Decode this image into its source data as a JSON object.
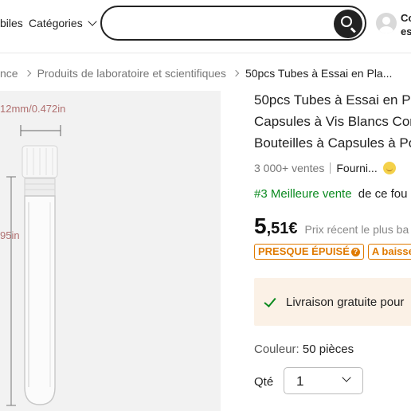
{
  "header": {
    "nav_mobiles": "biles",
    "nav_categories": "Catégories",
    "search": {
      "value": "",
      "placeholder": ""
    },
    "account_line1": "Co",
    "account_line2": "es"
  },
  "breadcrumb": [
    "nce",
    "Produits de laboratoire et scientifiques",
    "50pcs Tubes à Essai en Pla..."
  ],
  "image": {
    "dimension_width": "12mm/0.472in",
    "dimension_height": "95in"
  },
  "product": {
    "title_lines": [
      "50pcs Tubes à Essai en Pl",
      "Capsules à Vis Blancs Cor",
      "Bouteilles à Capsules à Po"
    ],
    "sales": "3 000+ ventes",
    "supplier": "Fourni...",
    "bestseller_rank": "#3 Meilleure vente",
    "bestseller_rest": "de ce fou",
    "price_int": "5",
    "price_dec": ",51€",
    "price_note": "Prix récent le plus ba",
    "badge_stock": "PRESQUE ÉPUISÉ",
    "badge_stock_help": "?",
    "badge_drop": "A baisse",
    "shipping_text": "Livraison gratuite pour",
    "color_label": "Couleur:",
    "color_value": "50 pièces",
    "qty_label": "Qté",
    "qty_value": "1"
  },
  "colors": {
    "accent_orange": "#e07a00",
    "green": "#0a8a1f",
    "shipping_bg": "#fbf1e6",
    "dimension_text": "#b07070"
  }
}
